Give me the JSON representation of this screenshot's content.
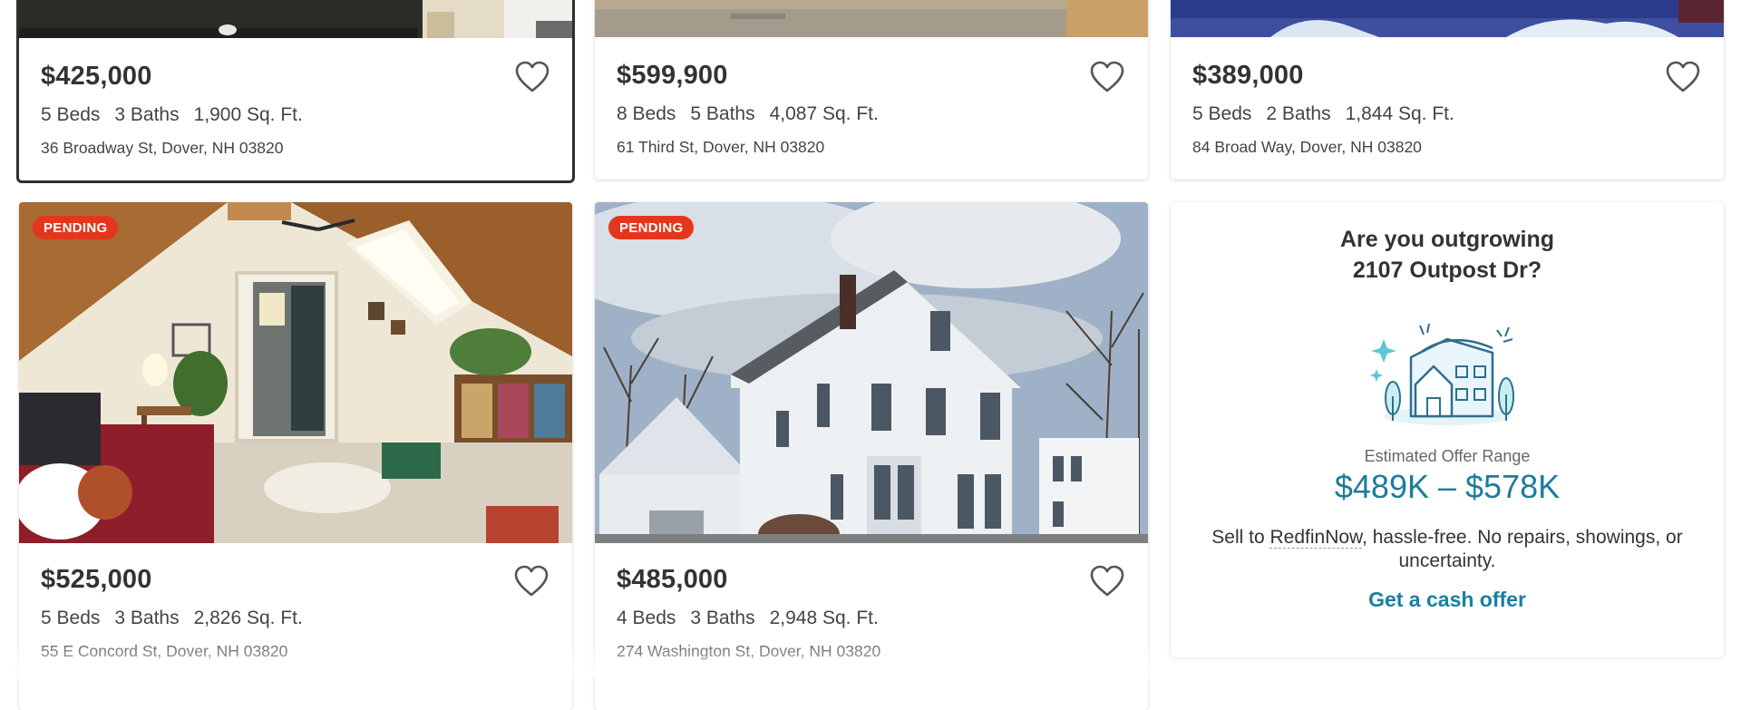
{
  "listings": [
    {
      "price": "$425,000",
      "beds": "5 Beds",
      "baths": "3 Baths",
      "sqft": "1,900 Sq. Ft.",
      "address": "36 Broadway St, Dover, NH 03820",
      "badge": ""
    },
    {
      "price": "$599,900",
      "beds": "8 Beds",
      "baths": "5 Baths",
      "sqft": "4,087 Sq. Ft.",
      "address": "61 Third St, Dover, NH 03820",
      "badge": ""
    },
    {
      "price": "$389,000",
      "beds": "5 Beds",
      "baths": "2 Baths",
      "sqft": "1,844 Sq. Ft.",
      "address": "84 Broad Way, Dover, NH 03820",
      "badge": ""
    },
    {
      "price": "$525,000",
      "beds": "5 Beds",
      "baths": "3 Baths",
      "sqft": "2,826 Sq. Ft.",
      "address": "55 E Concord St, Dover, NH 03820",
      "badge": "PENDING"
    },
    {
      "price": "$485,000",
      "beds": "4 Beds",
      "baths": "3 Baths",
      "sqft": "2,948 Sq. Ft.",
      "address": "274 Washington St, Dover, NH 03820",
      "badge": "PENDING"
    }
  ],
  "promo": {
    "title_line1": "Are you outgrowing",
    "title_line2": "2107 Outpost Dr?",
    "range_label": "Estimated Offer Range",
    "range": "$489K – $578K",
    "sell_prefix": "Sell to ",
    "sell_brand": "RedfinNow",
    "sell_suffix": ", hassle-free. No repairs, showings, or uncertainty.",
    "cta": "Get a cash offer",
    "illustration": "house-sparkle-illustration"
  },
  "icons": {
    "favorite": "heart-outline-icon"
  },
  "colors": {
    "badge": "#e4361c",
    "accent": "#1c7c9c",
    "cta": "#1a7fa1"
  }
}
